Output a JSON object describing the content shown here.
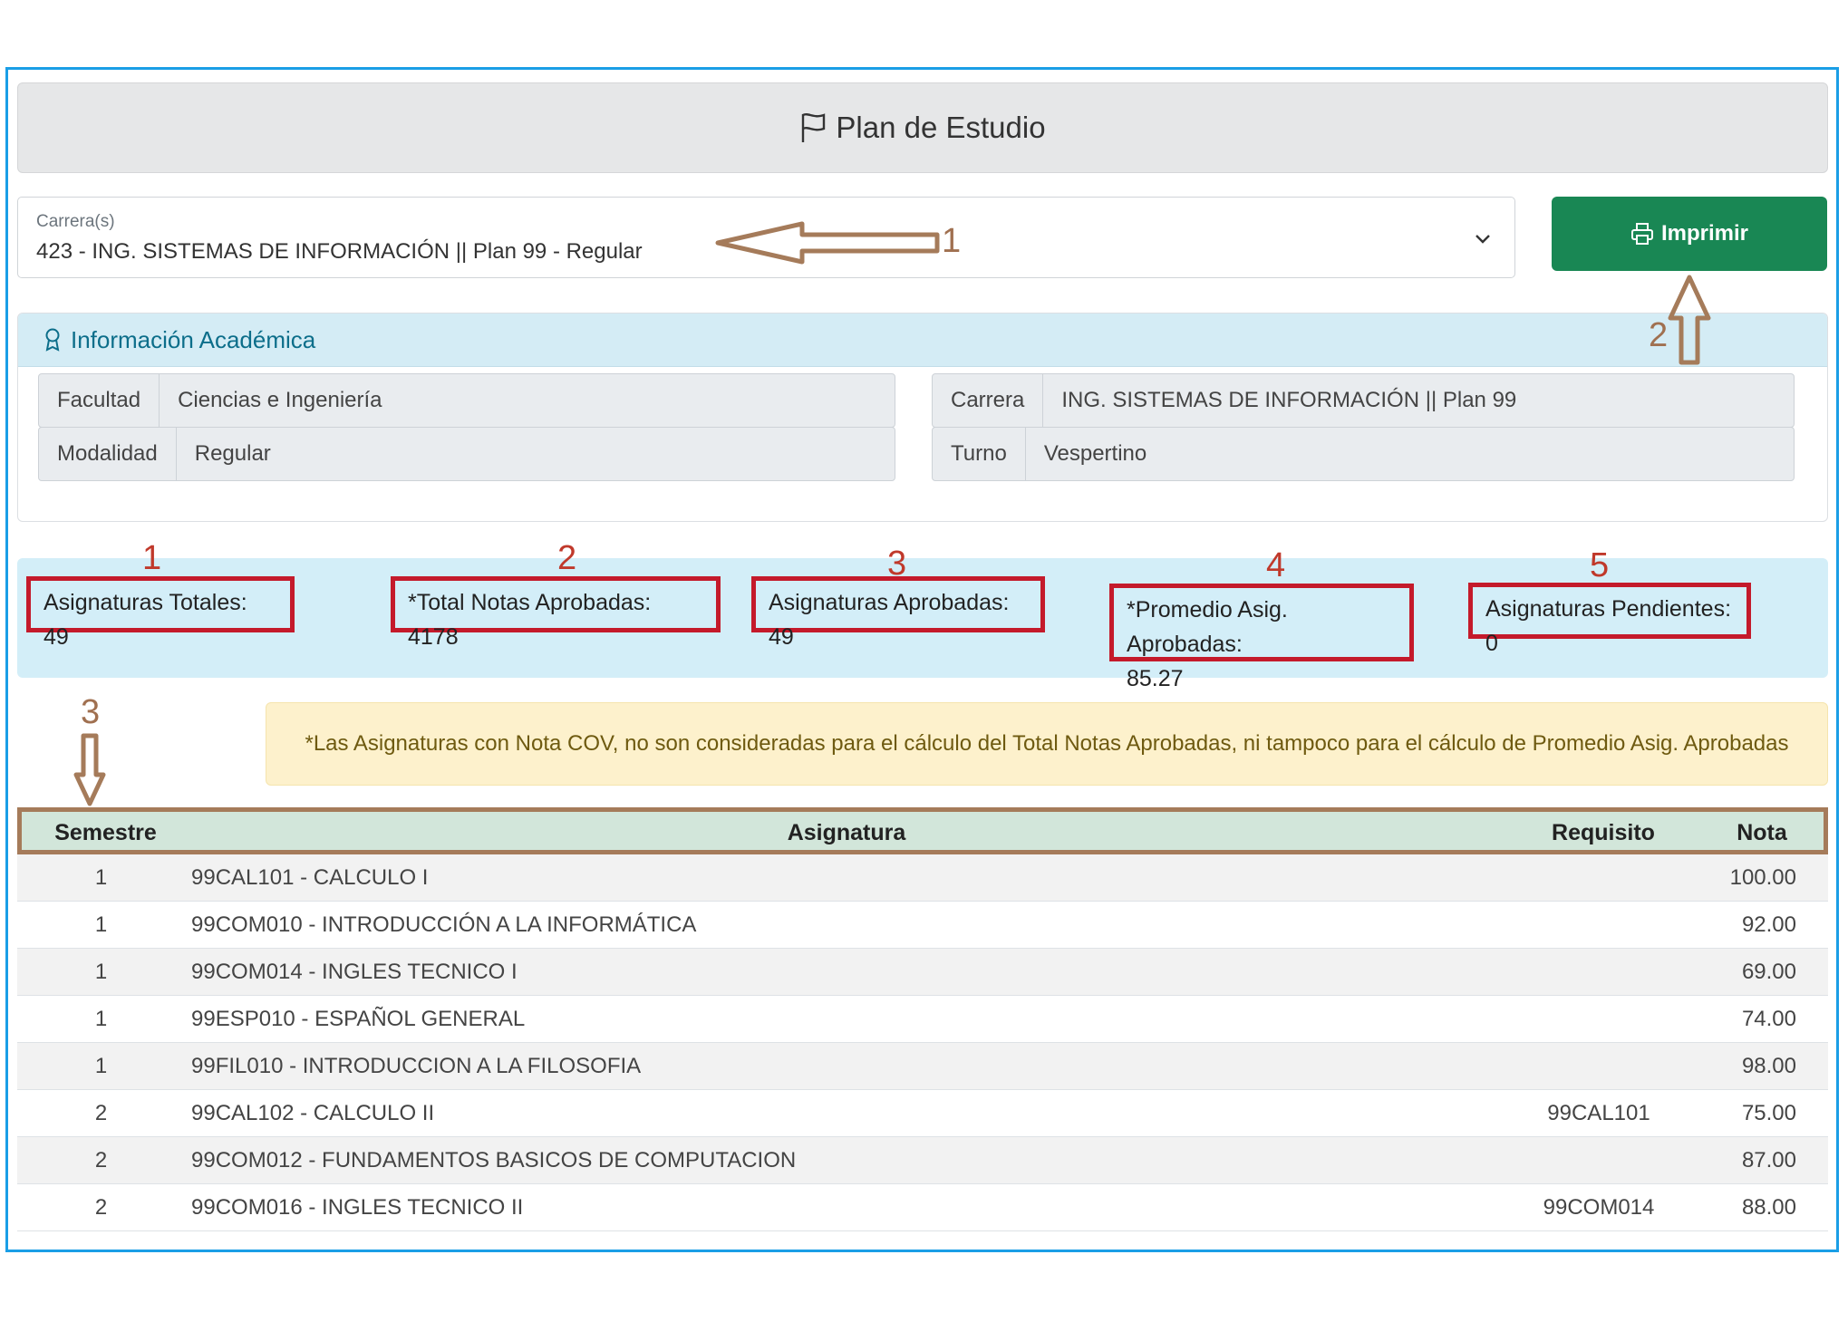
{
  "header": {
    "title": "Plan de Estudio",
    "icon": "flag-icon"
  },
  "career_select": {
    "label": "Carrera(s)",
    "value": "423 - ING. SISTEMAS DE INFORMACIÓN || Plan 99 - Regular"
  },
  "print_button": {
    "label": "Imprimir",
    "icon": "printer-icon",
    "color": "#198754"
  },
  "academic_info": {
    "title": "Información Académica",
    "icon": "award-icon",
    "facultad_label": "Facultad",
    "facultad_value": "Ciencias e Ingeniería",
    "modalidad_label": "Modalidad",
    "modalidad_value": "Regular",
    "carrera_label": "Carrera",
    "carrera_value": "ING. SISTEMAS DE INFORMACIÓN || Plan 99",
    "turno_label": "Turno",
    "turno_value": "Vespertino"
  },
  "stats": {
    "asignaturas_totales": "Asignaturas Totales: 49",
    "total_notas": "*Total Notas Aprobadas: 4178",
    "asignaturas_aprobadas": "Asignaturas Aprobadas: 49",
    "promedio_line1": "*Promedio Asig. Aprobadas:",
    "promedio_line2": "85.27",
    "pendientes": "Asignaturas Pendientes: 0"
  },
  "annotations": {
    "select_arrow": "1",
    "print_arrow": "2",
    "table_arrow": "3",
    "stat1": "1",
    "stat2": "2",
    "stat3": "3",
    "stat4": "4",
    "stat5": "5"
  },
  "alert": {
    "text": "*Las Asignaturas con Nota COV, no son consideradas para el cálculo del Total Notas Aprobadas, ni tampoco para el cálculo de Promedio Asig. Aprobadas"
  },
  "table": {
    "headers": {
      "semestre": "Semestre",
      "asignatura": "Asignatura",
      "requisito": "Requisito",
      "nota": "Nota"
    },
    "rows": [
      {
        "semestre": "1",
        "asignatura": "99CAL101 - CALCULO I",
        "requisito": "",
        "nota": "100.00"
      },
      {
        "semestre": "1",
        "asignatura": "99COM010 - INTRODUCCIÓN A LA INFORMÁTICA",
        "requisito": "",
        "nota": "92.00"
      },
      {
        "semestre": "1",
        "asignatura": "99COM014 - INGLES TECNICO I",
        "requisito": "",
        "nota": "69.00"
      },
      {
        "semestre": "1",
        "asignatura": "99ESP010 - ESPAÑOL GENERAL",
        "requisito": "",
        "nota": "74.00"
      },
      {
        "semestre": "1",
        "asignatura": "99FIL010 - INTRODUCCION A LA FILOSOFIA",
        "requisito": "",
        "nota": "98.00"
      },
      {
        "semestre": "2",
        "asignatura": "99CAL102 - CALCULO II",
        "requisito": "99CAL101",
        "nota": "75.00"
      },
      {
        "semestre": "2",
        "asignatura": "99COM012 - FUNDAMENTOS BASICOS DE COMPUTACION",
        "requisito": "",
        "nota": "87.00"
      },
      {
        "semestre": "2",
        "asignatura": "99COM016 - INGLES TECNICO II",
        "requisito": "99COM014",
        "nota": "88.00"
      }
    ]
  }
}
